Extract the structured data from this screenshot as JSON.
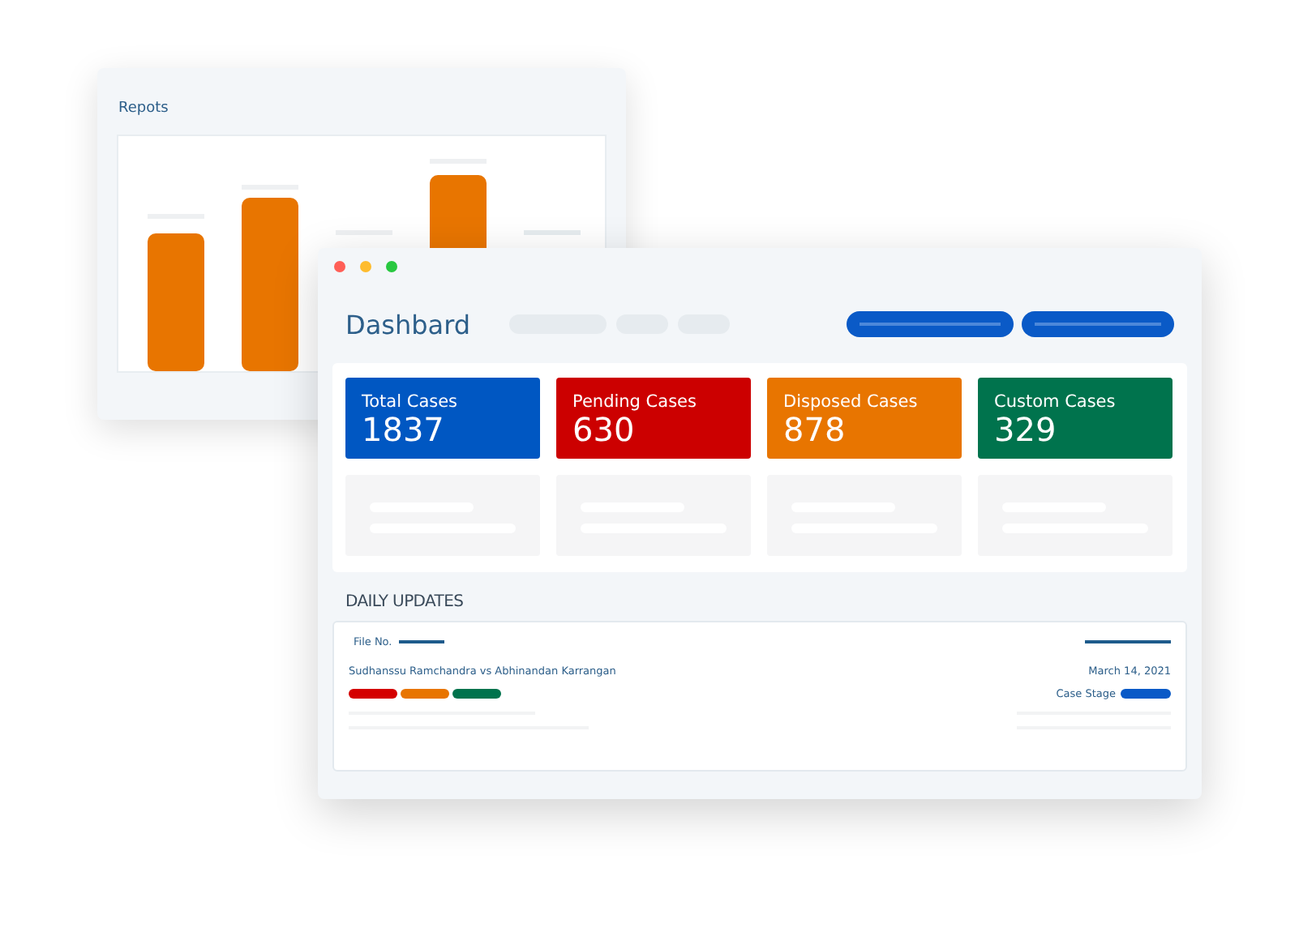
{
  "reports_window": {
    "title": "Repots"
  },
  "dashboard_window": {
    "title": "Dashbard",
    "stats": [
      {
        "label": "Total Cases",
        "value": "1837",
        "color": "#0057c2"
      },
      {
        "label": "Pending Cases",
        "value": "630",
        "color": "#cc0000"
      },
      {
        "label": "Disposed Cases",
        "value": "878",
        "color": "#e87500"
      },
      {
        "label": "Custom Cases",
        "value": "329",
        "color": "#00734d"
      }
    ],
    "daily_updates": {
      "heading": "DAILY UPDATES",
      "file_label": "File No.",
      "parties": "Sudhanssu Ramchandra vs Abhinandan Karrangan",
      "date": "March 14, 2021",
      "stage_label": "Case Stage",
      "tags": [
        {
          "color": "#d40000"
        },
        {
          "color": "#e87500"
        },
        {
          "color": "#00734d"
        }
      ]
    }
  }
}
